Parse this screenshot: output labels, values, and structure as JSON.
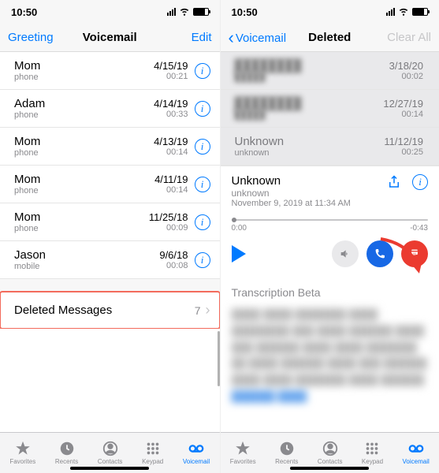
{
  "status": {
    "time": "10:50"
  },
  "left": {
    "nav": {
      "left": "Greeting",
      "title": "Voicemail",
      "right": "Edit"
    },
    "items": [
      {
        "name": "Mom",
        "sub": "phone",
        "date": "4/15/19",
        "dur": "00:21"
      },
      {
        "name": "Adam",
        "sub": "phone",
        "date": "4/14/19",
        "dur": "00:33"
      },
      {
        "name": "Mom",
        "sub": "phone",
        "date": "4/13/19",
        "dur": "00:14"
      },
      {
        "name": "Mom",
        "sub": "phone",
        "date": "4/11/19",
        "dur": "00:14"
      },
      {
        "name": "Mom",
        "sub": "phone",
        "date": "11/25/18",
        "dur": "00:09"
      },
      {
        "name": "Jason",
        "sub": "mobile",
        "date": "9/6/18",
        "dur": "00:08"
      }
    ],
    "deleted": {
      "label": "Deleted Messages",
      "count": "7"
    }
  },
  "right": {
    "nav": {
      "left": "Voicemail",
      "title": "Deleted",
      "right": "Clear All"
    },
    "items": [
      {
        "name": "████████",
        "sub": "█████",
        "date": "3/18/20",
        "dur": "00:02",
        "blurred": true
      },
      {
        "name": "████████",
        "sub": "█████",
        "date": "12/27/19",
        "dur": "00:14",
        "blurred": true
      },
      {
        "name": "Unknown",
        "sub": "unknown",
        "date": "11/12/19",
        "dur": "00:25",
        "blurred": false
      }
    ],
    "player": {
      "name": "Unknown",
      "sub": "unknown",
      "date": "November 9, 2019 at 11:34 AM",
      "time_start": "0:00",
      "time_end": "-0:43",
      "trans_label": "Transcription Beta"
    }
  },
  "tabs": {
    "favorites": "Favorites",
    "recents": "Recents",
    "contacts": "Contacts",
    "keypad": "Keypad",
    "voicemail": "Voicemail"
  }
}
